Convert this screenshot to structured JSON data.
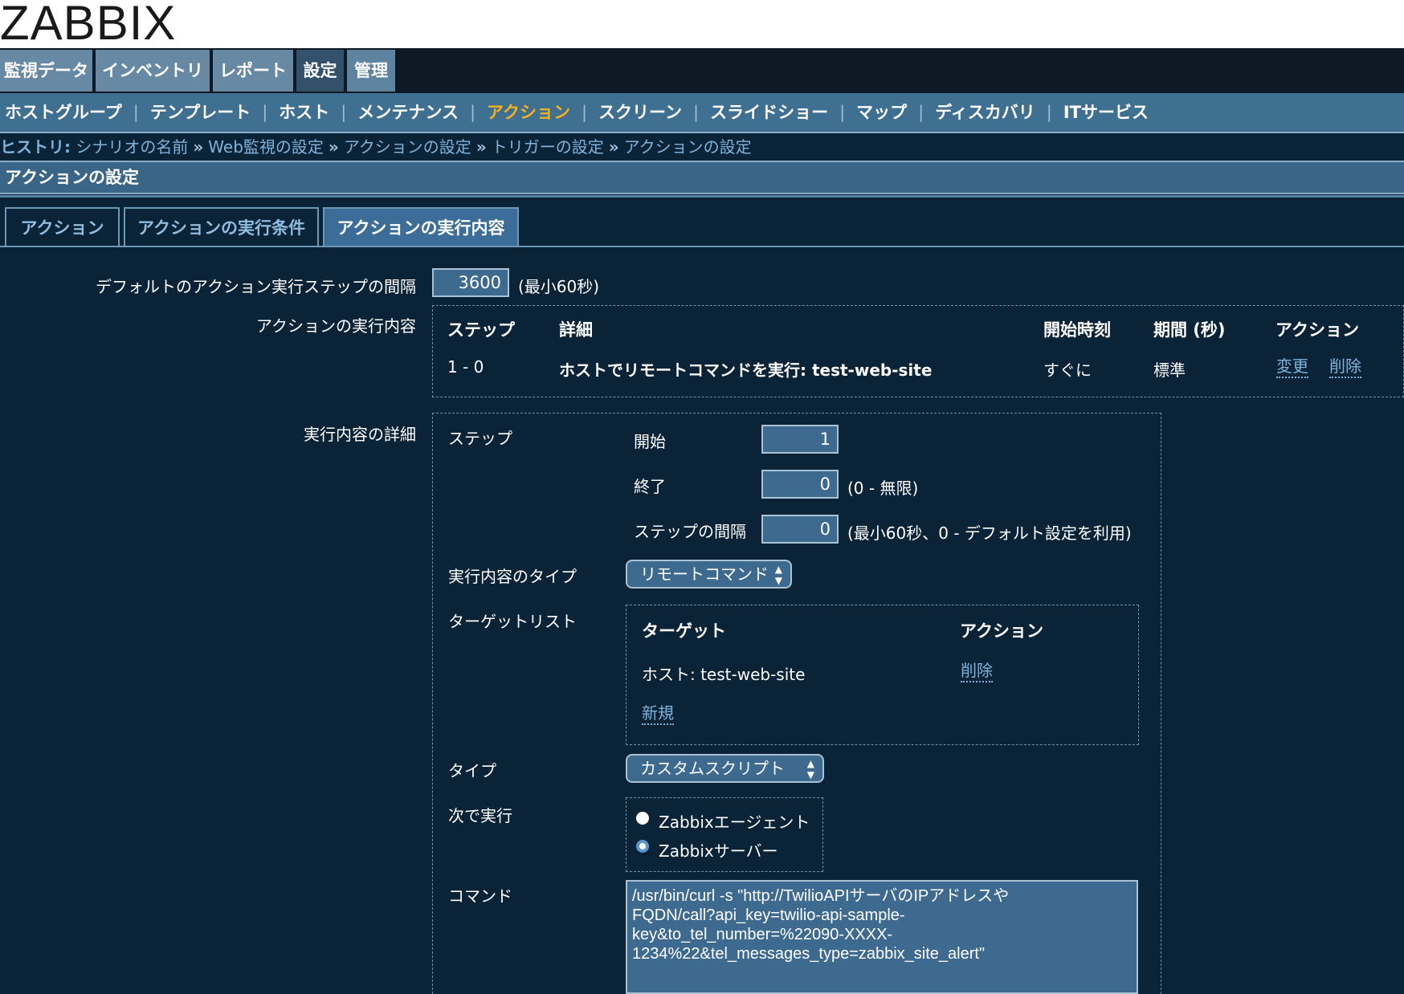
{
  "app": {
    "logo": "ZABBIX"
  },
  "main_menu": [
    {
      "label": "監視データ"
    },
    {
      "label": "インベントリ"
    },
    {
      "label": "レポート"
    },
    {
      "label": "設定"
    },
    {
      "label": "管理"
    }
  ],
  "sub_menu": [
    {
      "label": "ホストグループ"
    },
    {
      "label": "テンプレート"
    },
    {
      "label": "ホスト"
    },
    {
      "label": "メンテナンス"
    },
    {
      "label": "アクション"
    },
    {
      "label": "スクリーン"
    },
    {
      "label": "スライドショー"
    },
    {
      "label": "マップ"
    },
    {
      "label": "ディスカバリ"
    },
    {
      "label": "ITサービス"
    }
  ],
  "history": {
    "label": "ヒストリ:",
    "items": [
      "シナリオの名前",
      "Web監視の設定",
      "アクションの設定",
      "トリガーの設定",
      "アクションの設定"
    ],
    "separator": "»"
  },
  "page_title": "アクションの設定",
  "tabs": [
    {
      "label": "アクション"
    },
    {
      "label": "アクションの実行条件"
    },
    {
      "label": "アクションの実行内容"
    }
  ],
  "form": {
    "default_step_label": "デフォルトのアクション実行ステップの間隔",
    "default_step_value": "3600",
    "default_step_hint": "(最小60秒)",
    "operations_label": "アクションの実行内容",
    "operations_table": {
      "headers": [
        "ステップ",
        "詳細",
        "開始時刻",
        "期間 (秒)",
        "アクション"
      ],
      "rows": [
        {
          "step": "1 - 0",
          "detail": "ホストでリモートコマンドを実行: test-web-site",
          "start": "すぐに",
          "duration": "標準",
          "edit": "変更",
          "delete": "削除"
        }
      ]
    },
    "details_label": "実行内容の詳細",
    "step_label": "ステップ",
    "from_label": "開始",
    "from_value": "1",
    "to_label": "終了",
    "to_value": "0",
    "to_hint": "(0 - 無限)",
    "step_interval_label": "ステップの間隔",
    "step_interval_value": "0",
    "step_interval_hint": "(最小60秒、0 - デフォルト設定を利用)",
    "op_type_label": "実行内容のタイプ",
    "op_type_value": "リモートコマンド",
    "target_list_label": "ターゲットリスト",
    "target_table": {
      "headers": [
        "ターゲット",
        "アクション"
      ],
      "rows": [
        {
          "target": "ホスト: test-web-site",
          "action": "削除"
        }
      ],
      "new_link": "新規"
    },
    "type_label": "タイプ",
    "type_value": "カスタムスクリプト",
    "execute_on_label": "次で実行",
    "execute_on_options": [
      {
        "label": "Zabbixエージェント",
        "checked": false
      },
      {
        "label": "Zabbixサーバー",
        "checked": true
      }
    ],
    "command_label": "コマンド",
    "command_lines": [
      "/usr/bin/curl -s \"http://TwilioAPIサーバのIPアドレスや",
      "FQDN/call?api_key=twilio-api-sample-",
      "key&to_tel_number=%22090-XXXX-",
      "1234%22&tel_messages_type=zabbix_site_alert\""
    ]
  },
  "colors": {
    "background": "#0a2336",
    "accent_active_menu": "#f2b21d",
    "link": "#7fb3dc",
    "input_bg": "#3d6a8e"
  }
}
